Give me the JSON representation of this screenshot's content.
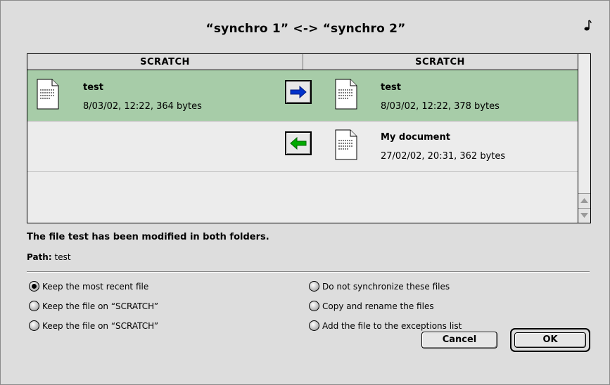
{
  "dialog": {
    "title": "“synchro 1” <-> “synchro 2”",
    "corner_icon": "note-icon"
  },
  "list": {
    "columns": [
      "SCRATCH",
      "SCRATCH"
    ],
    "selected_row_color": "#a7cca8",
    "rows": [
      {
        "left": {
          "name": "test",
          "meta": "8/03/02, 12:22, 364 bytes"
        },
        "direction": "right-arrow-icon",
        "arrow_color": "#0033cc",
        "right": {
          "name": "test",
          "meta": "8/03/02, 12:22, 378 bytes"
        },
        "selected": true
      },
      {
        "direction": "left-arrow-icon",
        "arrow_color": "#00aa00",
        "right": {
          "name": "My document",
          "meta": "27/02/02, 20:31, 362 bytes"
        },
        "selected": false
      }
    ]
  },
  "message": "The file test has been modified in both folders.",
  "path": {
    "label": "Path",
    "separator": ":",
    "value": "test"
  },
  "options": {
    "left": [
      {
        "label": "Keep the most recent file",
        "checked": true
      },
      {
        "label": "Keep the file on “SCRATCH”",
        "checked": false
      },
      {
        "label": "Keep the file on “SCRATCH”",
        "checked": false
      }
    ],
    "right": [
      {
        "label": "Do not synchronize these files",
        "checked": false
      },
      {
        "label": "Copy and rename the files",
        "checked": false
      },
      {
        "label": "Add the file to the exceptions list",
        "checked": false
      }
    ]
  },
  "buttons": {
    "cancel": "Cancel",
    "ok": "OK"
  }
}
